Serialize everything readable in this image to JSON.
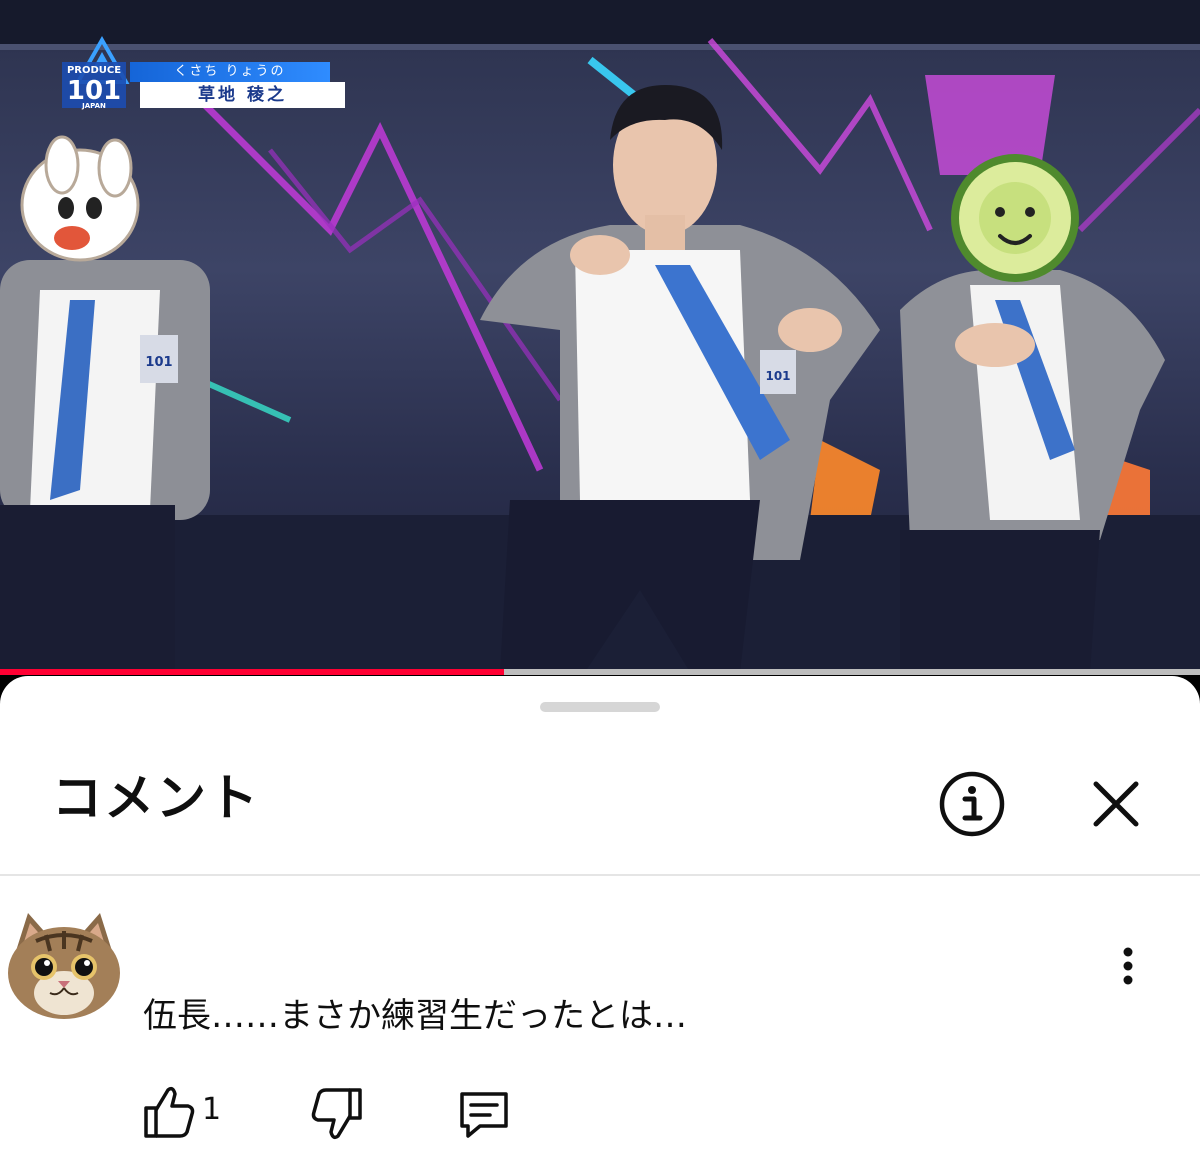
{
  "video": {
    "logo_top": "PRODUCE",
    "logo_number": "101",
    "logo_sub": "JAPAN",
    "badge_number": "101",
    "banner_kana": "くさち りょうの",
    "banner_kanji": "草地 稜之",
    "progress_fraction": 0.42,
    "colors": {
      "progress": "#ff0033",
      "track": "#bdbdbd",
      "banner_blue": "#1565d8"
    }
  },
  "comments_panel": {
    "title": "コメント",
    "info_icon": "info-circle-icon",
    "close_icon": "close-x-icon",
    "comment": {
      "avatar": "cat-face-avatar",
      "text": "伍長……まさか練習生だったとは…",
      "like_count": "1",
      "icons": [
        "thumbs-up-icon",
        "thumbs-down-icon",
        "reply-comment-icon",
        "more-vertical-icon"
      ]
    }
  }
}
